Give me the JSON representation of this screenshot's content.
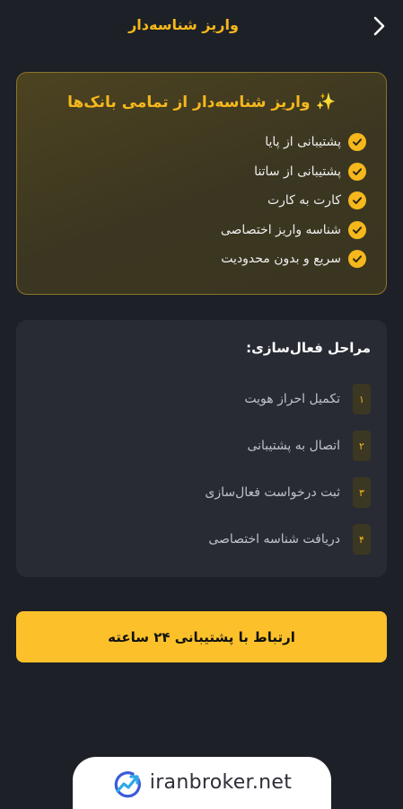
{
  "header": {
    "title": "واریز شناسه‌دار",
    "back_icon": "chevron-right-icon"
  },
  "promo": {
    "title": "واریز شناسه‌دار از تمامی بانک‌ها",
    "title_icon": "sparkles-icon",
    "features": [
      "پشتیبانی از پایا",
      "پشتیبانی از ساتنا",
      "کارت به کارت",
      "شناسه واریز اختصاصی",
      "سریع و بدون محدودیت"
    ],
    "check_icon": "check-circle-icon"
  },
  "steps": {
    "title": "مراحل فعال‌سازی:",
    "items": [
      {
        "num": "۱",
        "label": "تکمیل احراز هویت"
      },
      {
        "num": "۲",
        "label": "اتصال به پشتیبانی"
      },
      {
        "num": "۳",
        "label": "ثبت درخواست فعال‌سازی"
      },
      {
        "num": "۴",
        "label": "دریافت شناسه اختصاصی"
      }
    ]
  },
  "support_button": {
    "label": "ارتباط با پشتیبانی ۲۴ ساعته"
  },
  "brand": {
    "text": "iranbroker.net",
    "logo_icon": "chart-trend-logo-icon"
  },
  "colors": {
    "background": "#1d2027",
    "accent": "#f5b81c",
    "button": "#fcc12a",
    "card": "#282b33"
  }
}
